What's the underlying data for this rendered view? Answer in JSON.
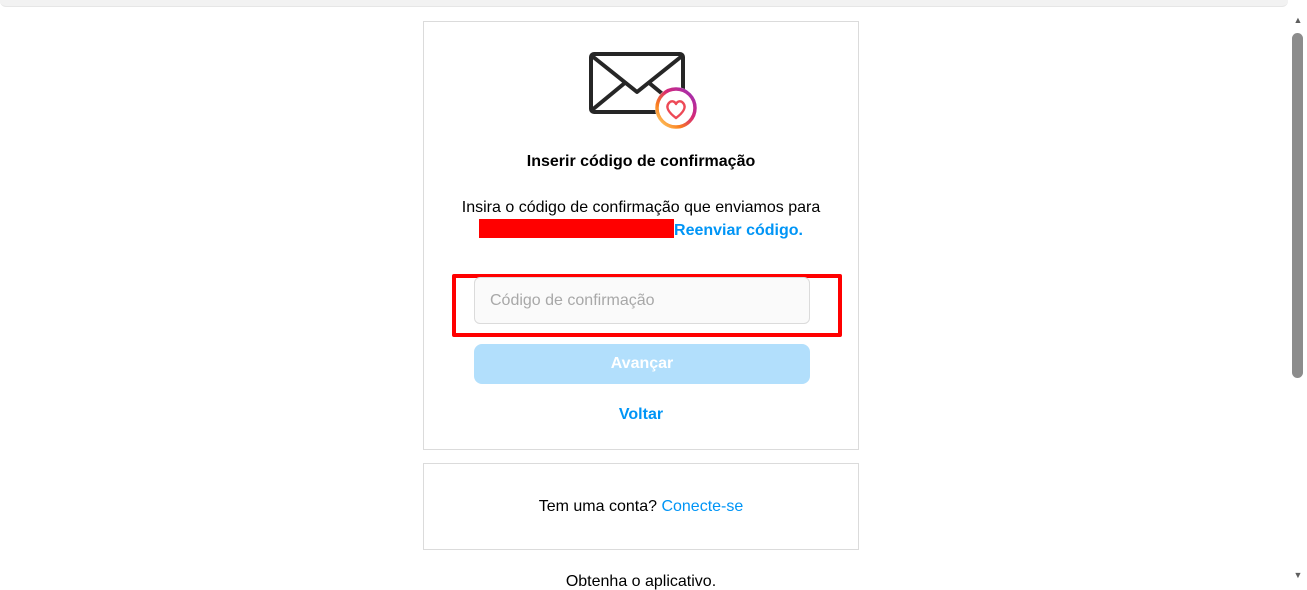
{
  "confirm": {
    "title": "Inserir código de confirmação",
    "description_prefix": "Insira o código de confirmação que enviamos para",
    "resend_label": "Reenviar código.",
    "code_placeholder": "Código de confirmação",
    "code_value": "",
    "next_label": "Avançar",
    "back_label": "Voltar"
  },
  "login_prompt": {
    "text": "Tem uma conta?",
    "link_label": "Conecte-se"
  },
  "footer": {
    "get_app": "Obtenha o aplicativo."
  },
  "icons": {
    "mail": "mail-heart-icon",
    "scroll_up": "scroll-up-arrow-icon",
    "scroll_down": "scroll-down-arrow-icon"
  },
  "colors": {
    "link": "#0095f6",
    "button_disabled": "#b2dffc",
    "highlight": "#ff0000",
    "border": "#dbdbdb"
  }
}
